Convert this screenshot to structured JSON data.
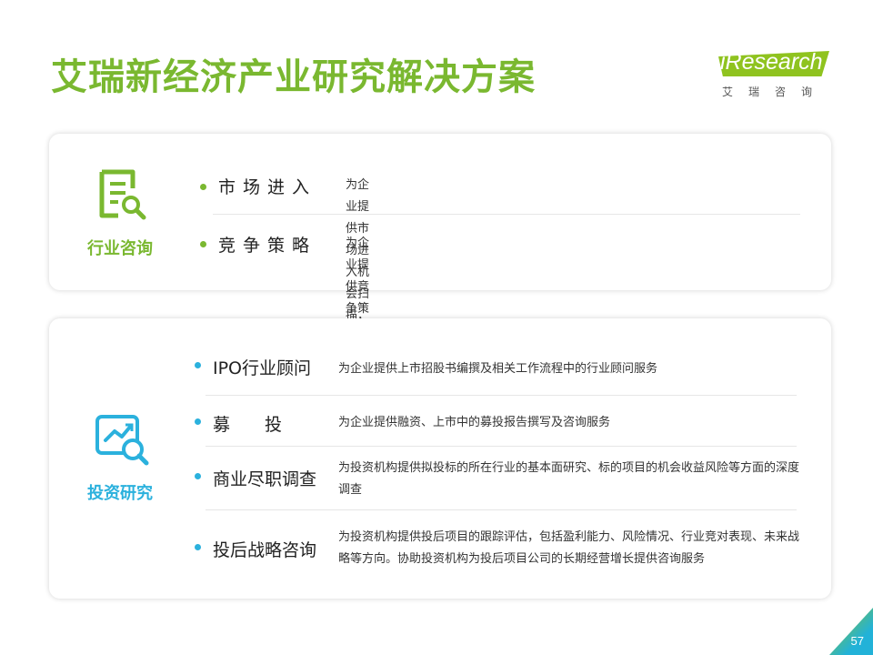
{
  "header": {
    "title": "艾瑞新经济产业研究解决方案",
    "logo_main": "iResearch",
    "logo_sub": "艾瑞咨询"
  },
  "colors": {
    "green": "#7ab830",
    "blue": "#2bb1dd"
  },
  "sections": [
    {
      "label": "行业咨询",
      "icon": "document-search-icon",
      "items": [
        {
          "name": "市场进入",
          "desc": "为企业提供市场进入机会扫描，可行性分析及路径规划"
        },
        {
          "name": "竞争策略",
          "desc": "为企业提供竞争策略制定，帮助企业构建长期竞争壁垒"
        }
      ]
    },
    {
      "label": "投资研究",
      "icon": "chart-magnifier-icon",
      "items": [
        {
          "name": "IPO行业顾问",
          "desc": "为企业提供上市招股书编撰及相关工作流程中的行业顾问服务"
        },
        {
          "name": "募　　投",
          "desc": "为企业提供融资、上市中的募投报告撰写及咨询服务"
        },
        {
          "name": "商业尽职调查",
          "desc": "为投资机构提供拟投标的所在行业的基本面研究、标的项目的机会收益风险等方面的深度调查"
        },
        {
          "name": "投后战略咨询",
          "desc": "为投资机构提供投后项目的跟踪评估，包括盈利能力、风险情况、行业竞对表现、未来战略等方向。协助投资机构为投后项目公司的长期经营增长提供咨询服务"
        }
      ]
    }
  ],
  "page_number": "57"
}
